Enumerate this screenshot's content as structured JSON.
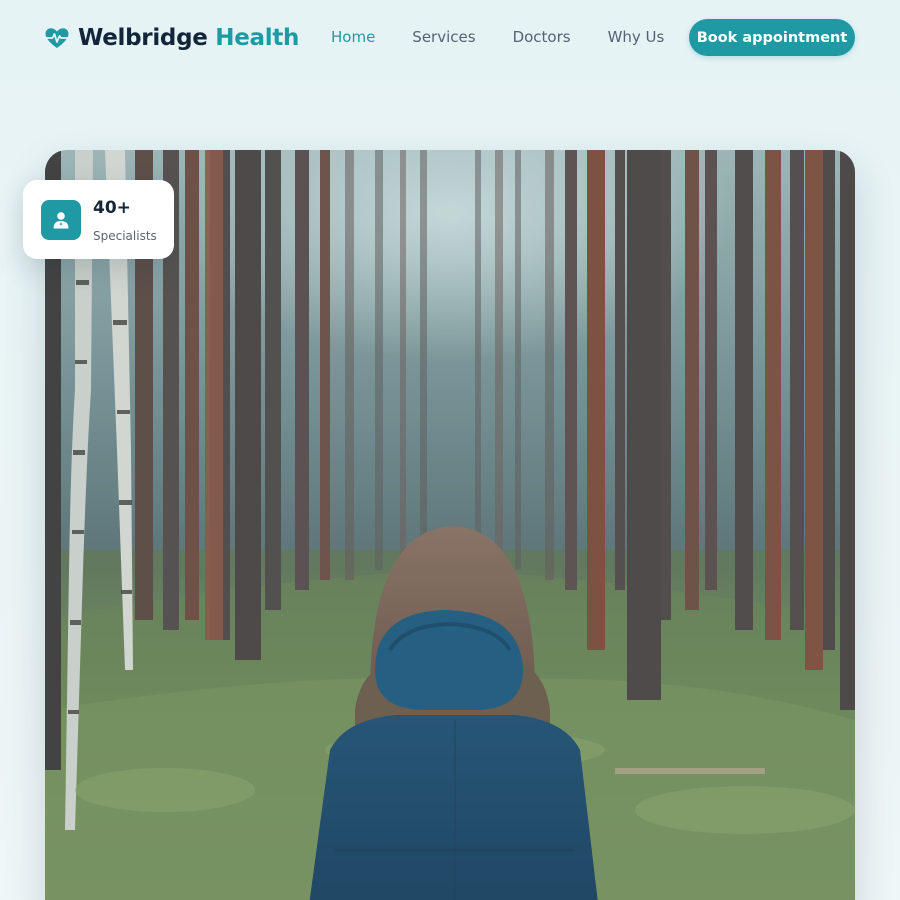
{
  "brand": {
    "name": "Welbridge",
    "accent": "Health",
    "icon": "heart-pulse-icon"
  },
  "nav": {
    "items": [
      {
        "label": "Home",
        "active": true
      },
      {
        "label": "Services",
        "active": false
      },
      {
        "label": "Doctors",
        "active": false
      },
      {
        "label": "Why Us",
        "active": false
      }
    ]
  },
  "cta": {
    "label": "Book appointment"
  },
  "stat_card": {
    "value": "40+",
    "label": "Specialists",
    "icon": "doctor-icon"
  },
  "hero": {
    "image": "person-in-blue-hooded-jacket-in-pine-forest"
  },
  "colors": {
    "accent": "#1f9aa5",
    "text_dark": "#13253a",
    "nav_text": "#566273",
    "background": "#e8f3f4"
  }
}
